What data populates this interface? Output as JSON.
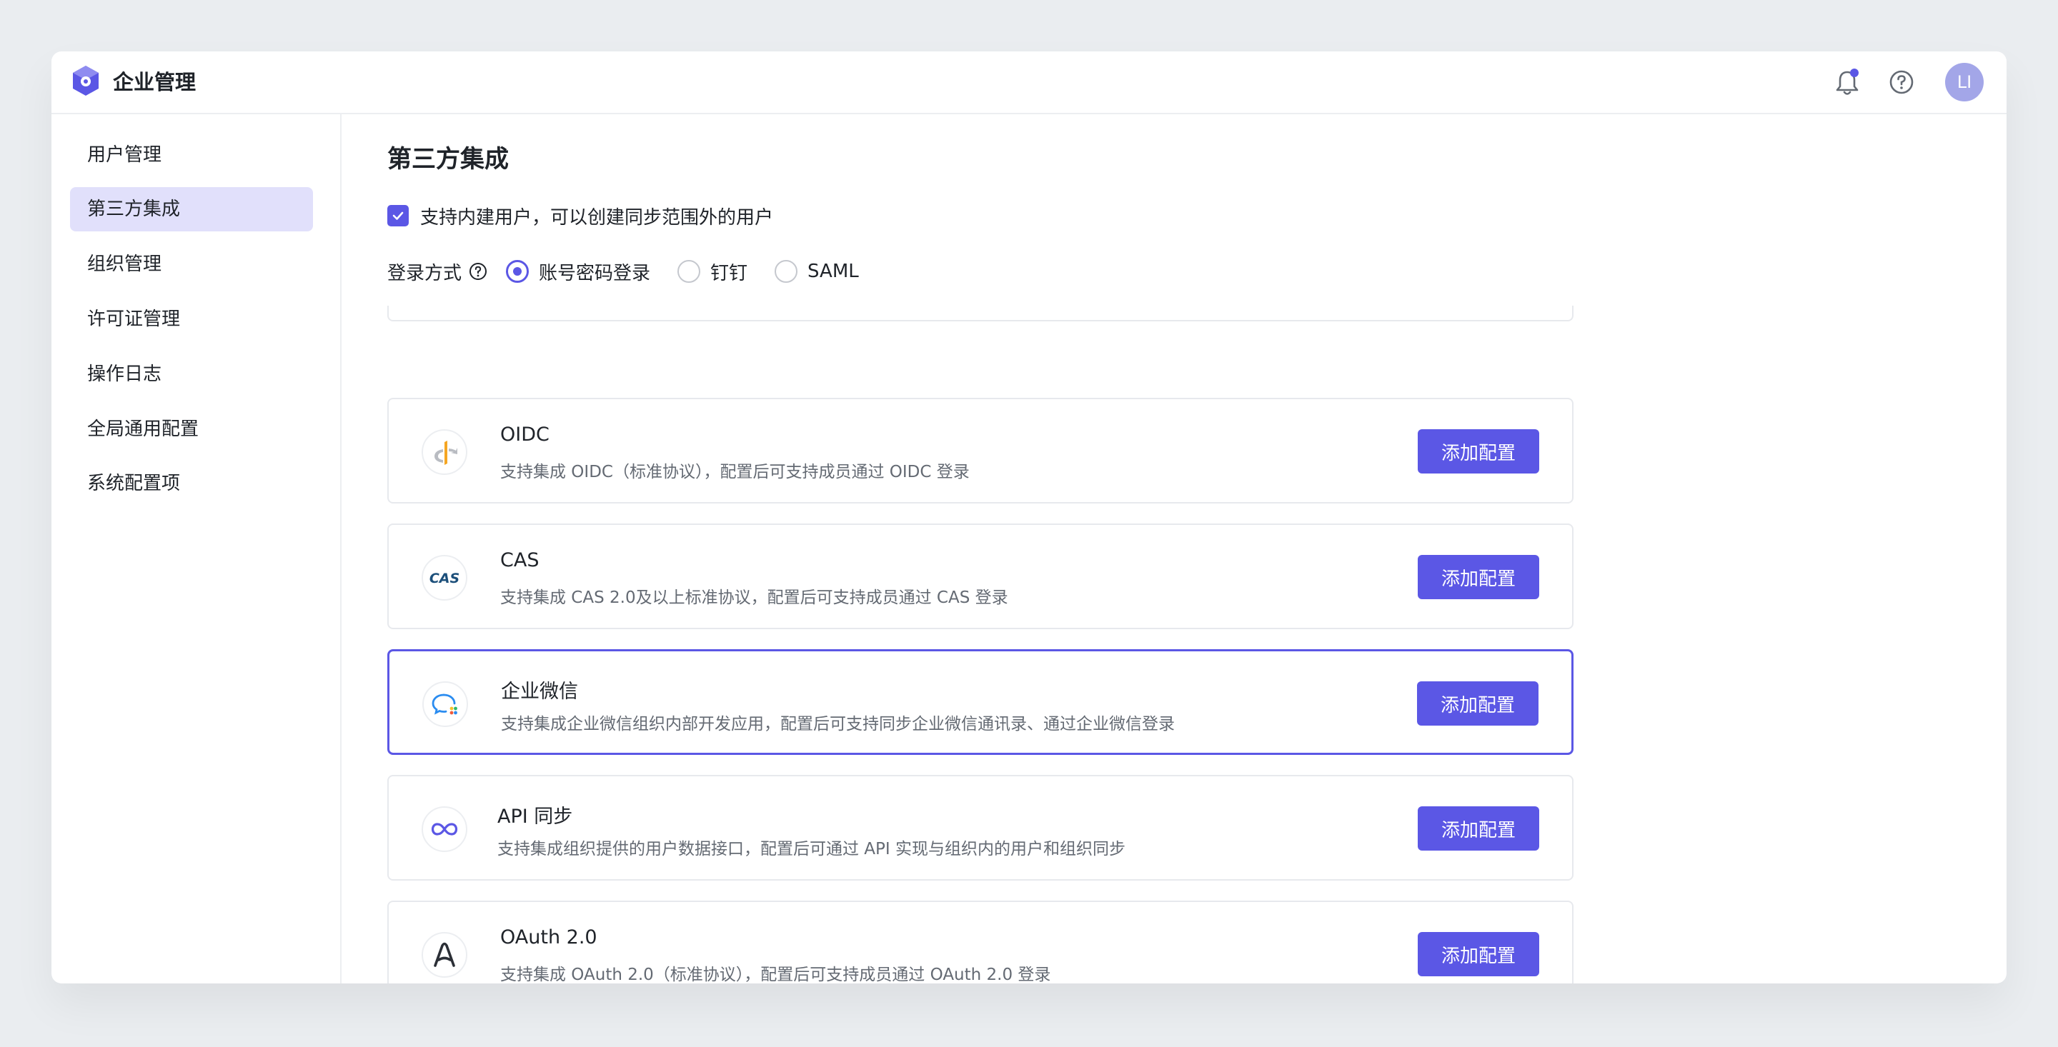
{
  "app": {
    "title": "企业管理",
    "avatar": "LI"
  },
  "sidebar": {
    "items": [
      {
        "label": "用户管理",
        "active": false
      },
      {
        "label": "第三方集成",
        "active": true
      },
      {
        "label": "组织管理",
        "active": false
      },
      {
        "label": "许可证管理",
        "active": false
      },
      {
        "label": "操作日志",
        "active": false
      },
      {
        "label": "全局通用配置",
        "active": false
      },
      {
        "label": "系统配置项",
        "active": false
      }
    ]
  },
  "main": {
    "title": "第三方集成",
    "builtin_users": {
      "checked": true,
      "label": "支持内建用户，可以创建同步范围外的用户"
    },
    "login": {
      "label": "登录方式",
      "options": [
        {
          "label": "账号密码登录",
          "selected": true
        },
        {
          "label": "钉钉",
          "selected": false
        },
        {
          "label": "SAML",
          "selected": false
        }
      ]
    },
    "integrations": [
      {
        "title": "OIDC",
        "desc": "支持集成 OIDC（标准协议），配置后可支持成员通过 OIDC 登录",
        "button": "添加配置",
        "icon": "oidc-icon",
        "selected": false
      },
      {
        "title": "CAS",
        "desc": "支持集成 CAS 2.0及以上标准协议，配置后可支持成员通过 CAS 登录",
        "button": "添加配置",
        "icon": "cas-icon",
        "icon_text": "CAS",
        "selected": false
      },
      {
        "title": "企业微信",
        "desc": "支持集成企业微信组织内部开发应用，配置后可支持同步企业微信通讯录、通过企业微信登录",
        "button": "添加配置",
        "icon": "wecom-icon",
        "selected": true
      },
      {
        "title": "API 同步",
        "desc": "支持集成组织提供的用户数据接口，配置后可通过 API 实现与组织内的用户和组织同步",
        "button": "添加配置",
        "icon": "infinity-icon",
        "selected": false
      },
      {
        "title": "OAuth 2.0",
        "desc": "支持集成 OAuth 2.0（标准协议），配置后可支持成员通过 OAuth 2.0 登录",
        "button": "添加配置",
        "icon": "oauth-icon",
        "selected": false
      }
    ]
  },
  "colors": {
    "accent": "#5b57e5",
    "active_bg": "#e1e0fb",
    "notify_dot": "#5b57e5"
  }
}
